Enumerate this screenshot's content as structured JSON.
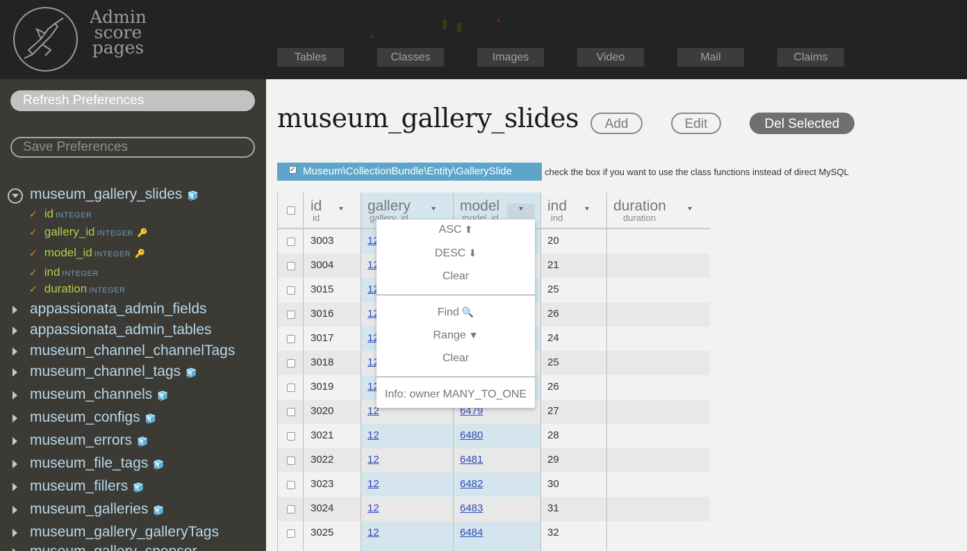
{
  "app": {
    "logo_lines": [
      "Admin",
      "score",
      "pages"
    ]
  },
  "nav": {
    "tabs": [
      "Tables",
      "Classes",
      "Images",
      "Video",
      "Mail",
      "Claims"
    ]
  },
  "sidebar": {
    "refresh_label": "Refresh Preferences",
    "save_label": "Save Preferences",
    "open_table": {
      "name": "museum_gallery_slides",
      "fields": [
        {
          "name": "id",
          "type": "INTEGER",
          "key": false
        },
        {
          "name": "gallery_id",
          "type": "INTEGER",
          "key": true
        },
        {
          "name": "model_id",
          "type": "INTEGER",
          "key": true
        },
        {
          "name": "ind",
          "type": "INTEGER",
          "key": false
        },
        {
          "name": "duration",
          "type": "INTEGER",
          "key": false
        }
      ]
    },
    "tables": [
      {
        "name": "appassionata_admin_fields",
        "cube": false
      },
      {
        "name": "appassionata_admin_tables",
        "cube": false
      },
      {
        "name": "museum_channel_channelTags",
        "cube": false
      },
      {
        "name": "museum_channel_tags",
        "cube": true
      },
      {
        "name": "museum_channels",
        "cube": true
      },
      {
        "name": "museum_configs",
        "cube": true
      },
      {
        "name": "museum_errors",
        "cube": true
      },
      {
        "name": "museum_file_tags",
        "cube": true
      },
      {
        "name": "museum_fillers",
        "cube": true
      },
      {
        "name": "museum_galleries",
        "cube": true
      },
      {
        "name": "museum_gallery_galleryTags",
        "cube": false
      },
      {
        "name": "museum_gallery_sponsor",
        "cube": false
      }
    ]
  },
  "main": {
    "title": "museum_gallery_slides",
    "add_label": "Add",
    "edit_label": "Edit",
    "del_label": "Del Selected",
    "class_name": "Museum\\CollectionBundle\\Entity\\GallerySlide",
    "class_note": "check the box if you want to use the class functions instead of direct MySQL",
    "columns": [
      {
        "title": "id",
        "sub": "id"
      },
      {
        "title": "gallery",
        "sub": "gallery_id"
      },
      {
        "title": "model",
        "sub": "model_id"
      },
      {
        "title": "ind",
        "sub": "ind"
      },
      {
        "title": "duration",
        "sub": "duration"
      }
    ],
    "rows": [
      {
        "id": "3003",
        "gallery": "12",
        "model": "",
        "ind": "20"
      },
      {
        "id": "3004",
        "gallery": "12",
        "model": "",
        "ind": "21"
      },
      {
        "id": "3015",
        "gallery": "12",
        "model": "",
        "ind": "25"
      },
      {
        "id": "3016",
        "gallery": "12",
        "model": "",
        "ind": "26"
      },
      {
        "id": "3017",
        "gallery": "12",
        "model": "",
        "ind": "24"
      },
      {
        "id": "3018",
        "gallery": "12",
        "model": "",
        "ind": "25"
      },
      {
        "id": "3019",
        "gallery": "12",
        "model": "",
        "ind": "26"
      },
      {
        "id": "3020",
        "gallery": "12",
        "model": "6479",
        "ind": "27"
      },
      {
        "id": "3021",
        "gallery": "12",
        "model": "6480",
        "ind": "28"
      },
      {
        "id": "3022",
        "gallery": "12",
        "model": "6481",
        "ind": "29"
      },
      {
        "id": "3023",
        "gallery": "12",
        "model": "6482",
        "ind": "30"
      },
      {
        "id": "3024",
        "gallery": "12",
        "model": "6483",
        "ind": "31"
      },
      {
        "id": "3025",
        "gallery": "12",
        "model": "6484",
        "ind": "32"
      }
    ]
  },
  "dropdown": {
    "asc": "ASC",
    "desc": "DESC",
    "clear1": "Clear",
    "find": "Find",
    "range": "Range",
    "clear2": "Clear",
    "info": "Info: owner MANY_TO_ONE"
  },
  "colors": {
    "header_bg": "#232323",
    "sidebar_bg": "#3b3a35",
    "field_green": "#b9ca46",
    "class_box": "#5da6c9",
    "link_blue": "#2f4cba"
  }
}
